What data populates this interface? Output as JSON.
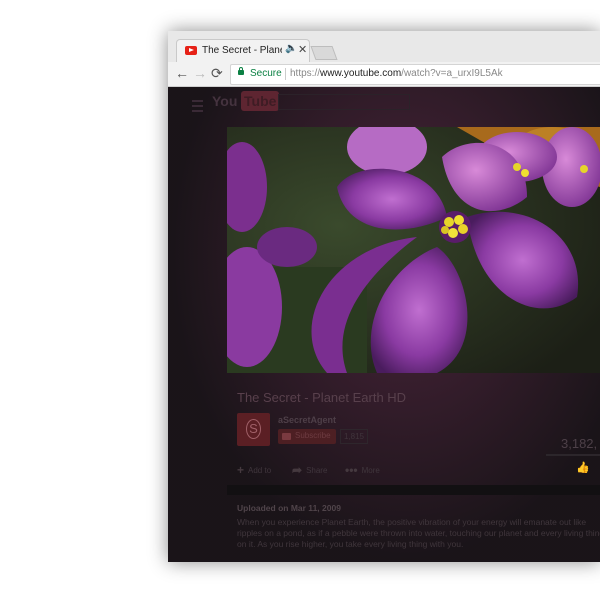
{
  "browser": {
    "tab": {
      "title": "The Secret - Planet Earth HD - YouTube",
      "audio_icon": "speaker-icon",
      "close_icon": "close-icon"
    },
    "nav": {
      "back": "←",
      "forward": "→",
      "reload": "⟳"
    },
    "address": {
      "secure_label": "Secure",
      "scheme": "https://",
      "host": "www.youtube.com",
      "path": "/watch?v=a_urxI9L5Ak"
    }
  },
  "youtube": {
    "logo_you": "You",
    "logo_tube": "Tube",
    "video": {
      "title": "The Secret - Planet Earth HD"
    },
    "channel": {
      "name": "aSecretAgent",
      "subscribe_label": "Subscribe",
      "sub_count": "1,815"
    },
    "views": "3,182,",
    "actions": {
      "add_icon": "+",
      "add_label": "Add to",
      "share_icon": "➦",
      "share_label": "Share",
      "more_icon": "•••",
      "more_label": "More",
      "like_icon": "👍"
    },
    "description": {
      "uploaded": "Uploaded on Mar 11, 2009",
      "text": "When you experience Planet Earth, the positive vibration of your energy will emanate out like ripples on a pond, as if a pebble were thrown into water, touching our planet and every living thing on it. As you rise higher, you take every living thing with you."
    }
  },
  "colors": {
    "secure_green": "#0b8043",
    "youtube_red": "#e62117",
    "overlay": "#161416"
  }
}
